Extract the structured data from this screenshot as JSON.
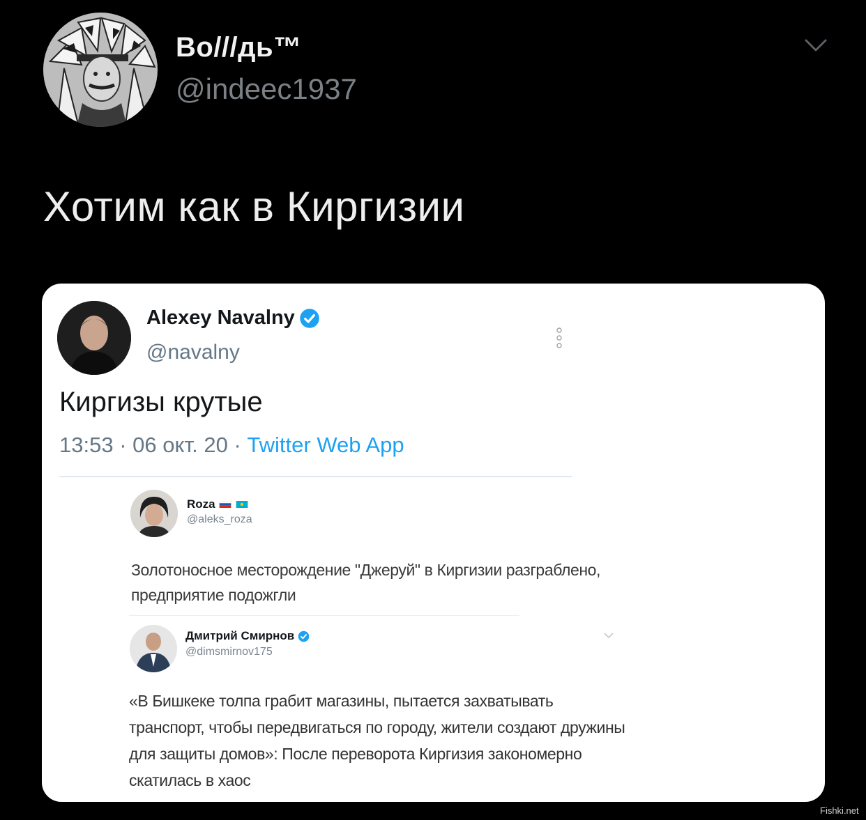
{
  "tweet": {
    "author_name": "Bo///дь™",
    "author_handle": "@indeec1937",
    "text": "Хотим как в Киргизии",
    "avatar_icon": "headdress-portrait-avatar",
    "menu_icon": "chevron-down-icon"
  },
  "embedded": {
    "author_name": "Alexey Navalny",
    "author_handle": "@navalny",
    "verified_icon": "verified-badge-icon",
    "text": "Киргизы крутые",
    "time": "13:53",
    "date": "06 окт. 20",
    "source": "Twitter Web App",
    "separator": " · "
  },
  "quotes": [
    {
      "author_name": "Roza",
      "author_handle": "@aleks_roza",
      "text": "Золотоносное месторождение \"Джеруй\" в Киргизии разграблено, предприятие подожгли"
    },
    {
      "author_name": "Дмитрий Смирнов",
      "author_handle": "@dimsmirnov175",
      "text": "«В Бишкеке толпа грабит магазины, пытается захватывать транспорт, чтобы передвигаться по городу, жители создают дружины для защиты домов»: После переворота Киргизия  закономерно скатилась в хаос"
    }
  ],
  "watermark": "Fishki.net",
  "colors": {
    "background": "#000000",
    "card": "#ffffff",
    "link": "#1da1f2",
    "verified": "#1da1f2",
    "muted": "#657786"
  }
}
